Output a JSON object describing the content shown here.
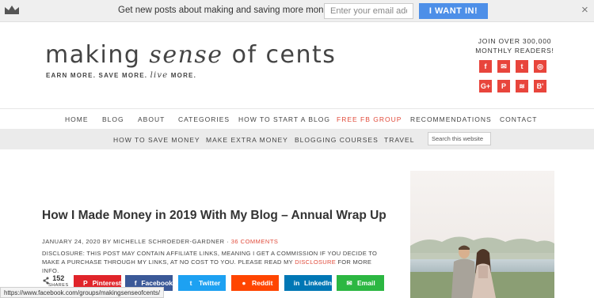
{
  "topbar": {
    "message": "Get new posts about making and saving more money by email",
    "email_placeholder": "Enter your email address",
    "button_label": "I WANT IN!",
    "close_label": "×"
  },
  "header": {
    "logo_part1": "making ",
    "logo_part2": "sense",
    "logo_part3": " of cents",
    "tagline_part1": "EARN MORE. SAVE MORE. ",
    "tagline_live": "live",
    "tagline_part2": " MORE.",
    "join_line1": "JOIN OVER 300,000",
    "join_line2": "MONTHLY READERS!",
    "social": [
      {
        "icon": "facebook-icon",
        "glyph": "f"
      },
      {
        "icon": "email-icon",
        "glyph": "✉"
      },
      {
        "icon": "twitter-icon",
        "glyph": "t"
      },
      {
        "icon": "instagram-icon",
        "glyph": "◎"
      },
      {
        "icon": "google-plus-icon",
        "glyph": "G+"
      },
      {
        "icon": "pinterest-icon",
        "glyph": "P"
      },
      {
        "icon": "rss-icon",
        "glyph": "≋"
      },
      {
        "icon": "bloglovin-icon",
        "glyph": "B'"
      }
    ],
    "accent_color": "#e8453c"
  },
  "nav_primary": [
    "HOME",
    "BLOG",
    "ABOUT",
    "CATEGORIES",
    "HOW TO START A BLOG",
    "FREE FB GROUP",
    "RECOMMENDATIONS",
    "CONTACT"
  ],
  "nav_secondary": [
    "HOW TO SAVE MONEY",
    "MAKE EXTRA MONEY",
    "BLOGGING COURSES",
    "TRAVEL"
  ],
  "search_placeholder": "Search this website",
  "post": {
    "title": "How I Made Money in 2019 With My Blog – Annual Wrap Up",
    "meta_prefix": "JANUARY 24, 2020 BY MICHELLE SCHROEDER-GARDNER · ",
    "comments": "36 COMMENTS",
    "disclosure_text": "DISCLOSURE: THIS POST MAY CONTAIN AFFILIATE LINKS, MEANING I GET A COMMISSION IF YOU DECIDE TO MAKE A PURCHASE THROUGH MY LINKS, AT NO COST TO YOU. PLEASE READ MY ",
    "disclosure_link": "DISCLOSURE",
    "disclosure_end": " FOR MORE INFO."
  },
  "share": {
    "count": "152",
    "count_label": "SHARES",
    "buttons": [
      {
        "label": "Pinterest",
        "glyph": "P",
        "color": "#e0242a",
        "icon": "pinterest-icon"
      },
      {
        "label": "Facebook",
        "glyph": "f",
        "color": "#3b5998",
        "icon": "facebook-icon"
      },
      {
        "label": "Twitter",
        "glyph": "t",
        "color": "#1da1f2",
        "icon": "twitter-icon"
      },
      {
        "label": "Reddit",
        "glyph": "●",
        "color": "#ff4500",
        "icon": "reddit-icon"
      },
      {
        "label": "LinkedIn",
        "glyph": "in",
        "color": "#0077b5",
        "icon": "linkedin-icon"
      },
      {
        "label": "Email",
        "glyph": "✉",
        "color": "#2cb742",
        "icon": "email-icon"
      }
    ]
  },
  "status_url": "https://www.facebook.com/groups/makingsenseofcents/"
}
